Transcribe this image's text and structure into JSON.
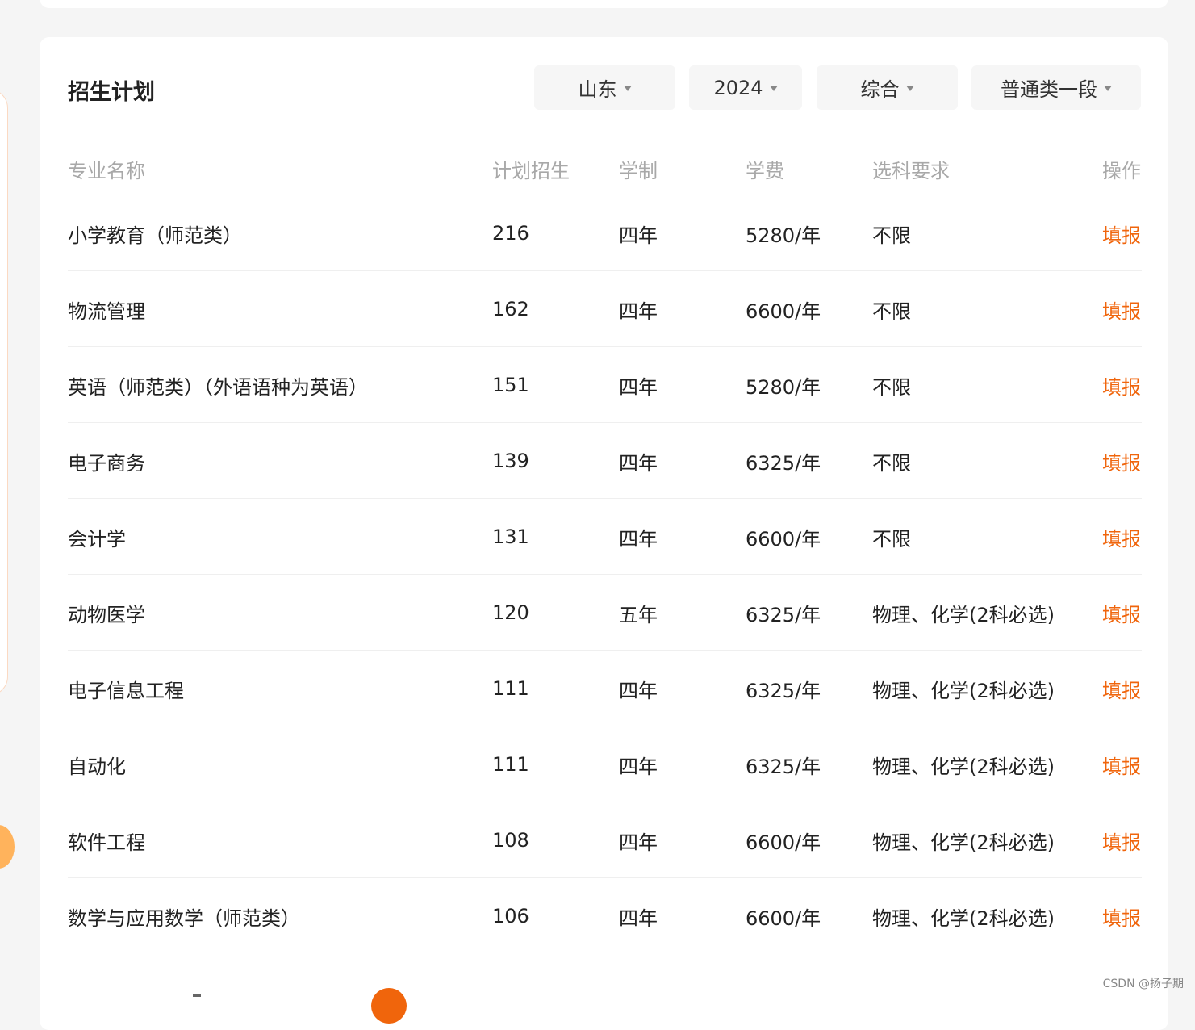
{
  "section": {
    "title": "招生计划"
  },
  "filters": {
    "province": "山东",
    "year": "2024",
    "category": "综合",
    "batch": "普通类一段"
  },
  "table": {
    "headers": {
      "name": "专业名称",
      "plan": "计划招生",
      "years": "学制",
      "fee": "学费",
      "requirement": "选科要求",
      "action": "操作"
    },
    "rows": [
      {
        "name": "小学教育（师范类）",
        "plan": "216",
        "years": "四年",
        "fee": "5280/年",
        "requirement": "不限",
        "action": "填报"
      },
      {
        "name": "物流管理",
        "plan": "162",
        "years": "四年",
        "fee": "6600/年",
        "requirement": "不限",
        "action": "填报"
      },
      {
        "name": "英语（师范类）（外语语种为英语）",
        "plan": "151",
        "years": "四年",
        "fee": "5280/年",
        "requirement": "不限",
        "action": "填报"
      },
      {
        "name": "电子商务",
        "plan": "139",
        "years": "四年",
        "fee": "6325/年",
        "requirement": "不限",
        "action": "填报"
      },
      {
        "name": "会计学",
        "plan": "131",
        "years": "四年",
        "fee": "6600/年",
        "requirement": "不限",
        "action": "填报"
      },
      {
        "name": "动物医学",
        "plan": "120",
        "years": "五年",
        "fee": "6325/年",
        "requirement": "物理、化学(2科必选)",
        "action": "填报"
      },
      {
        "name": "电子信息工程",
        "plan": "111",
        "years": "四年",
        "fee": "6325/年",
        "requirement": "物理、化学(2科必选)",
        "action": "填报"
      },
      {
        "name": "自动化",
        "plan": "111",
        "years": "四年",
        "fee": "6325/年",
        "requirement": "物理、化学(2科必选)",
        "action": "填报"
      },
      {
        "name": "软件工程",
        "plan": "108",
        "years": "四年",
        "fee": "6600/年",
        "requirement": "物理、化学(2科必选)",
        "action": "填报"
      },
      {
        "name": "数学与应用数学（师范类）",
        "plan": "106",
        "years": "四年",
        "fee": "6600/年",
        "requirement": "物理、化学(2科必选)",
        "action": "填报"
      }
    ]
  },
  "watermark": "CSDN @扬子期",
  "colors": {
    "accent": "#f0650c",
    "header_text": "#a8a8a8",
    "filter_bg": "#f6f6f6",
    "page_bg": "#f5f5f5"
  }
}
